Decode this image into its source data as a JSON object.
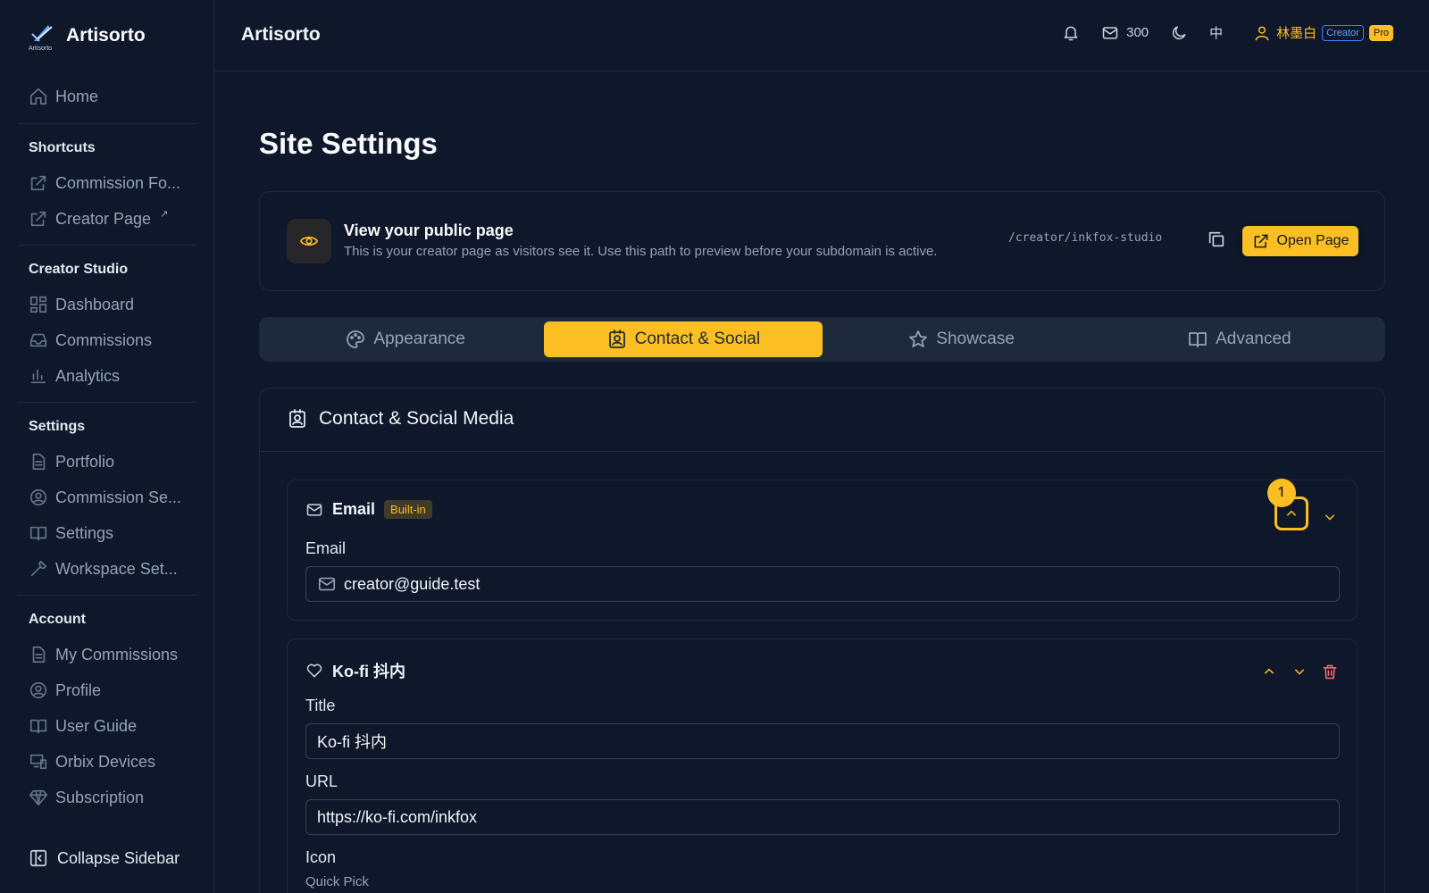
{
  "brand": {
    "name": "Artisorto",
    "logo_caption": "Artisorto"
  },
  "sidebar": {
    "home": "Home",
    "sections": {
      "shortcuts": "Shortcuts",
      "creator_studio": "Creator Studio",
      "settings": "Settings",
      "account": "Account"
    },
    "shortcuts": [
      {
        "label": "Commission Fo...",
        "icon": "external-link-icon"
      },
      {
        "label": "Creator Page",
        "icon": "external-link-icon",
        "superscript": "↗"
      }
    ],
    "creator_studio": [
      {
        "label": "Dashboard",
        "icon": "dashboard-icon"
      },
      {
        "label": "Commissions",
        "icon": "inbox-icon"
      },
      {
        "label": "Analytics",
        "icon": "chart-icon"
      }
    ],
    "settings": [
      {
        "label": "Portfolio",
        "icon": "document-icon"
      },
      {
        "label": "Commission Se...",
        "icon": "user-circle-icon"
      },
      {
        "label": "Settings",
        "icon": "book-icon"
      },
      {
        "label": "Workspace Set...",
        "icon": "wrench-icon"
      }
    ],
    "account": [
      {
        "label": "My Commissions",
        "icon": "document-icon"
      },
      {
        "label": "Profile",
        "icon": "user-circle-icon"
      },
      {
        "label": "User Guide",
        "icon": "book-icon"
      },
      {
        "label": "Orbix Devices",
        "icon": "devices-icon"
      },
      {
        "label": "Subscription",
        "icon": "diamond-icon"
      }
    ],
    "collapse": "Collapse Sidebar"
  },
  "topbar": {
    "title": "Artisorto",
    "mail_count": "300",
    "lang": "中",
    "user_name": "林墨白",
    "badge_creator": "Creator",
    "badge_pro": "Pro"
  },
  "main": {
    "page_title": "Site Settings",
    "public_page": {
      "title": "View your public page",
      "description": "This is your creator page as visitors see it. Use this path to preview before your subdomain is active.",
      "path": "/creator/inkfox-studio",
      "open_button": "Open Page"
    },
    "tabs": [
      {
        "label": "Appearance",
        "icon": "palette-icon",
        "active": false
      },
      {
        "label": "Contact & Social",
        "icon": "contact-icon",
        "active": true
      },
      {
        "label": "Showcase",
        "icon": "star-icon",
        "active": false
      },
      {
        "label": "Advanced",
        "icon": "book-icon",
        "active": false
      }
    ],
    "section_title": "Contact & Social Media",
    "email_card": {
      "title": "Email",
      "badge": "Built-in",
      "field_label": "Email",
      "value": "creator@guide.test",
      "marker": "1"
    },
    "kofi_card": {
      "title": "Ko-fi 抖内",
      "title_label": "Title",
      "title_value": "Ko-fi 抖内",
      "url_label": "URL",
      "url_value": "https://ko-fi.com/inkfox",
      "icon_label": "Icon",
      "quick_pick": "Quick Pick"
    }
  },
  "colors": {
    "accent": "#fbbf24",
    "background": "#0f172a",
    "danger": "#f87171"
  }
}
